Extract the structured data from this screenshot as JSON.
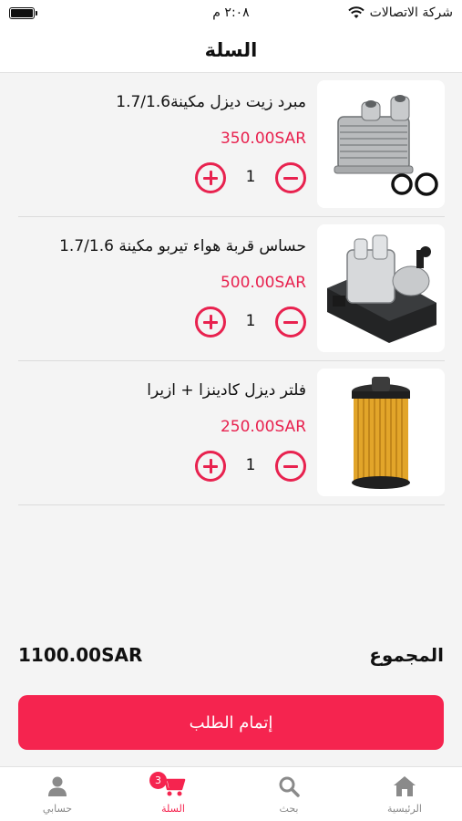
{
  "status_bar": {
    "carrier": "شركة الاتصالات",
    "time": "٢:٠٨ م"
  },
  "header": {
    "title": "السلة"
  },
  "cart": {
    "items": [
      {
        "name": "مبرد زيت ديزل مكينة1.7/1.6",
        "price": "350.00SAR",
        "quantity": "1",
        "image_icon": "oil-cooler-icon"
      },
      {
        "name": "حساس قربة هواء تيربو مكينة 1.7/1.6",
        "price": "500.00SAR",
        "quantity": "1",
        "image_icon": "turbo-actuator-icon"
      },
      {
        "name": "فلتر ديزل كادينزا + ازيرا",
        "price": "250.00SAR",
        "quantity": "1",
        "image_icon": "fuel-filter-icon"
      }
    ]
  },
  "summary": {
    "total_label": "المجموع",
    "total_value": "1100.00SAR"
  },
  "checkout": {
    "label": "إتمام الطلب"
  },
  "tab_bar": {
    "tabs": [
      {
        "label": "الرئيسية",
        "icon": "home-icon"
      },
      {
        "label": "بحث",
        "icon": "search-icon"
      },
      {
        "label": "السلة",
        "icon": "cart-icon",
        "badge": "3",
        "active": true
      },
      {
        "label": "حسابي",
        "icon": "user-icon"
      }
    ]
  },
  "colors": {
    "accent": "#f5244f",
    "price": "#e8224f",
    "background": "#f4f4f4"
  }
}
